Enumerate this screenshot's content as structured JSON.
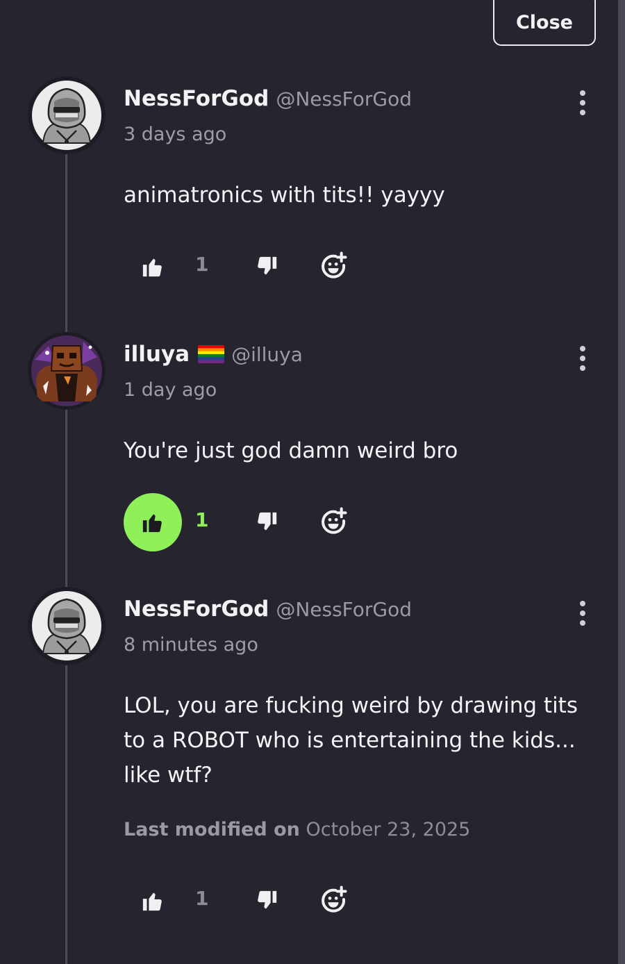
{
  "close_label": "Close",
  "colors": {
    "background": "#25242f",
    "accent_green": "#8ff05a",
    "muted_text": "#9e9daa"
  },
  "comments": [
    {
      "author": "NessForGod",
      "handle": "@NessForGod",
      "time": "3 days ago",
      "text": "animatronics with tits!! yayyy",
      "likes": "1",
      "liked": false,
      "avatar": "hooded-gray-robot-avatar"
    },
    {
      "author": "illuya",
      "flag": "rainbow-flag",
      "handle": "@illuya",
      "time": "1 day ago",
      "text": "You're just god damn weird bro",
      "likes": "1",
      "liked": true,
      "avatar": "orange-bear-character-avatar"
    },
    {
      "author": "NessForGod",
      "handle": "@NessForGod",
      "time": "8 minutes ago",
      "text_lines": [
        "LOL, you are fucking weird by drawing tits",
        "to a ROBOT who is entertaining the kids...",
        "like wtf?"
      ],
      "modified_label": "Last modified on",
      "modified_date": "October 23, 2025",
      "likes": "1",
      "liked": false,
      "avatar": "hooded-gray-robot-avatar"
    }
  ]
}
